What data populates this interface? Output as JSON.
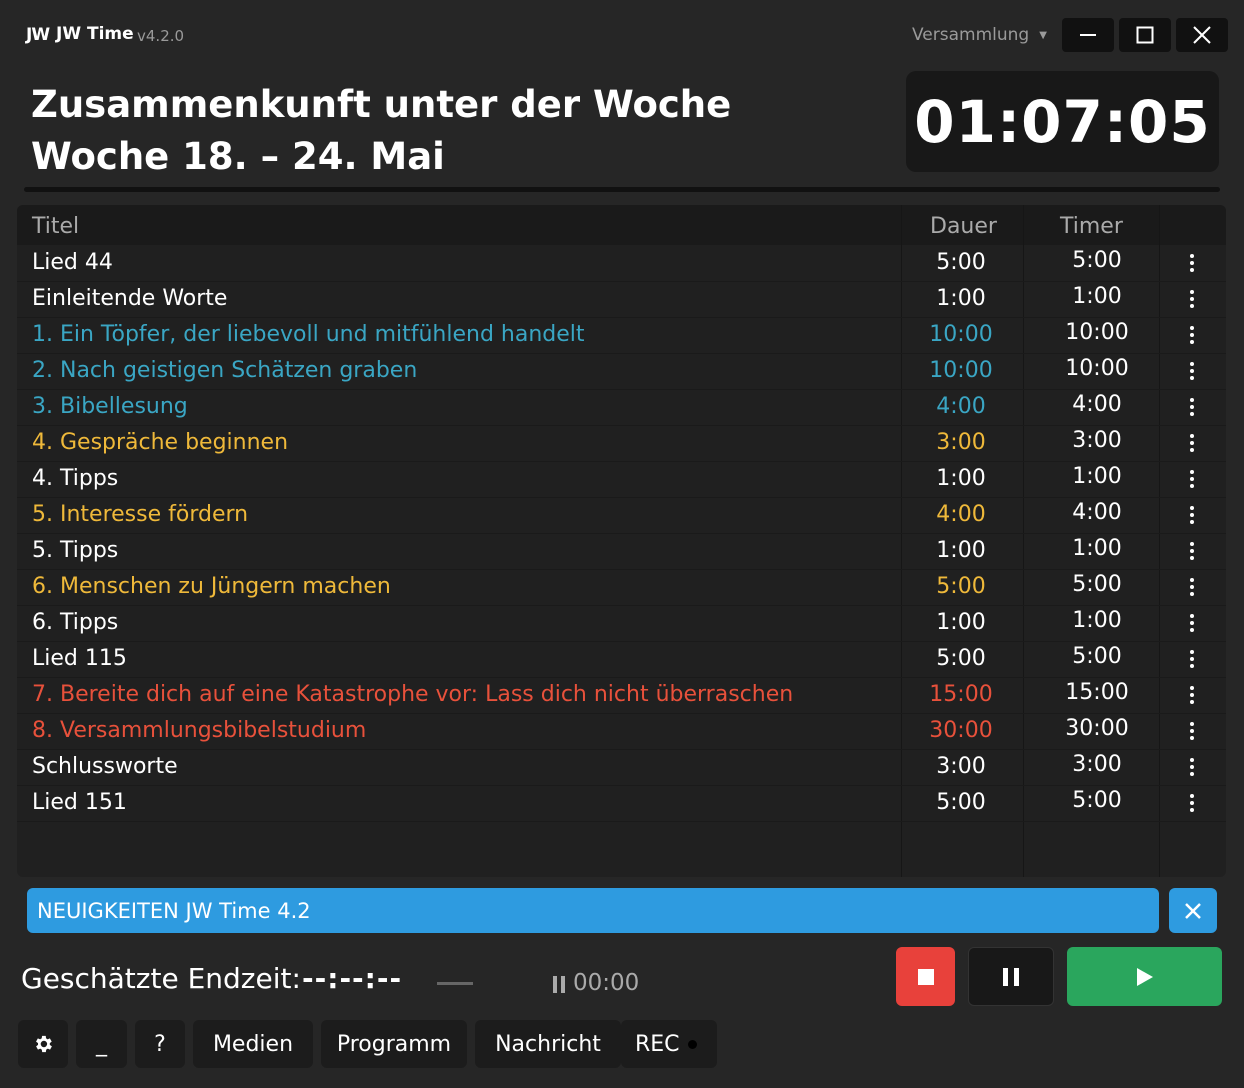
{
  "app": {
    "logo": "JW",
    "name": "JW Time",
    "version": "v4.2.0",
    "mode": "Versammlung"
  },
  "header": {
    "title": "Zusammenkunft unter der Woche",
    "week": "Woche 18. – 24. Mai",
    "clock": "01:07:05"
  },
  "table": {
    "headers": {
      "title": "Titel",
      "duration": "Dauer",
      "timer": "Timer"
    },
    "rows": [
      {
        "title": "Lied 44",
        "duration": "5:00",
        "timer": "5:00",
        "color": "#ffffff"
      },
      {
        "title": "Einleitende Worte",
        "duration": "1:00",
        "timer": "1:00",
        "color": "#ffffff"
      },
      {
        "title": "1. Ein Töpfer, der liebevoll und mitfühlend handelt",
        "duration": "10:00",
        "timer": "10:00",
        "color": "#3aa6c4"
      },
      {
        "title": "2. Nach geistigen Schätzen graben",
        "duration": "10:00",
        "timer": "10:00",
        "color": "#3aa6c4"
      },
      {
        "title": "3. Bibellesung",
        "duration": "4:00",
        "timer": "4:00",
        "color": "#3aa6c4"
      },
      {
        "title": "4. Gespräche beginnen",
        "duration": "3:00",
        "timer": "3:00",
        "color": "#efb93a"
      },
      {
        "title": "4. Tipps",
        "duration": "1:00",
        "timer": "1:00",
        "color": "#ffffff"
      },
      {
        "title": "5. Interesse fördern",
        "duration": "4:00",
        "timer": "4:00",
        "color": "#efb93a"
      },
      {
        "title": "5. Tipps",
        "duration": "1:00",
        "timer": "1:00",
        "color": "#ffffff"
      },
      {
        "title": "6. Menschen zu Jüngern machen",
        "duration": "5:00",
        "timer": "5:00",
        "color": "#efb93a"
      },
      {
        "title": "6. Tipps",
        "duration": "1:00",
        "timer": "1:00",
        "color": "#ffffff"
      },
      {
        "title": "Lied 115",
        "duration": "5:00",
        "timer": "5:00",
        "color": "#ffffff"
      },
      {
        "title": "7. Bereite dich auf eine Katastrophe vor: Lass dich nicht überraschen",
        "duration": "15:00",
        "timer": "15:00",
        "color": "#e8513b"
      },
      {
        "title": "8. Versammlungsbibelstudium",
        "duration": "30:00",
        "timer": "30:00",
        "color": "#e8513b"
      },
      {
        "title": "Schlussworte",
        "duration": "3:00",
        "timer": "3:00",
        "color": "#ffffff"
      },
      {
        "title": "Lied 151",
        "duration": "5:00",
        "timer": "5:00",
        "color": "#ffffff"
      }
    ]
  },
  "news": {
    "text": "NEUIGKEITEN JW Time 4.2"
  },
  "status": {
    "end_label": "Geschätzte Endzeit:",
    "end_value": "--:--:--",
    "pause_time": "00:00"
  },
  "bottom": {
    "minimize": "_",
    "help": "?",
    "media": "Medien",
    "program": "Programm",
    "message": "Nachricht",
    "rec": "REC"
  },
  "colors": {
    "accent_blue": "#2e9be0",
    "stop_red": "#e8413b",
    "play_green": "#2aa65d",
    "section_treasures": "#3aa6c4",
    "section_ministry": "#efb93a",
    "section_living": "#e8513b"
  }
}
